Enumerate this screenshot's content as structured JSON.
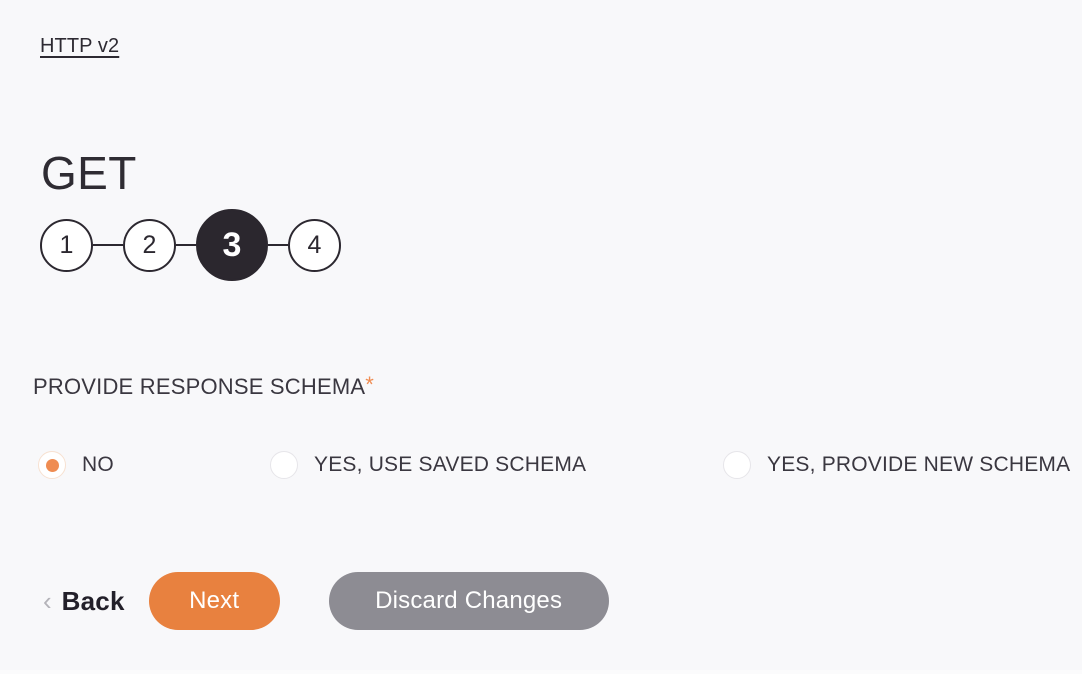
{
  "breadcrumb": {
    "label": "HTTP v2"
  },
  "page": {
    "title": "GET"
  },
  "stepper": {
    "current": 3,
    "steps": [
      {
        "number": "1",
        "state": "upcoming"
      },
      {
        "number": "2",
        "state": "upcoming"
      },
      {
        "number": "3",
        "state": "current"
      },
      {
        "number": "4",
        "state": "upcoming"
      }
    ]
  },
  "form": {
    "field_label": "PROVIDE RESPONSE SCHEMA",
    "required_marker": "*",
    "required_marker_color": "#ef8c52",
    "selected_value": "NO",
    "options": [
      {
        "label": "NO",
        "checked": true
      },
      {
        "label": "YES, USE SAVED SCHEMA",
        "checked": false
      },
      {
        "label": "YES, PROVIDE NEW SCHEMA",
        "checked": false
      }
    ]
  },
  "actions": {
    "back_chevron": "‹",
    "back_label": "Back",
    "next_label": "Next",
    "discard_label": "Discard Changes"
  },
  "colors": {
    "background": "#f8f8fa",
    "accent_orange": "#e8813f",
    "radio_orange": "#ef8c52",
    "dark": "#2b272e",
    "gray_button": "#8d8c93",
    "text": "#3a3740"
  }
}
